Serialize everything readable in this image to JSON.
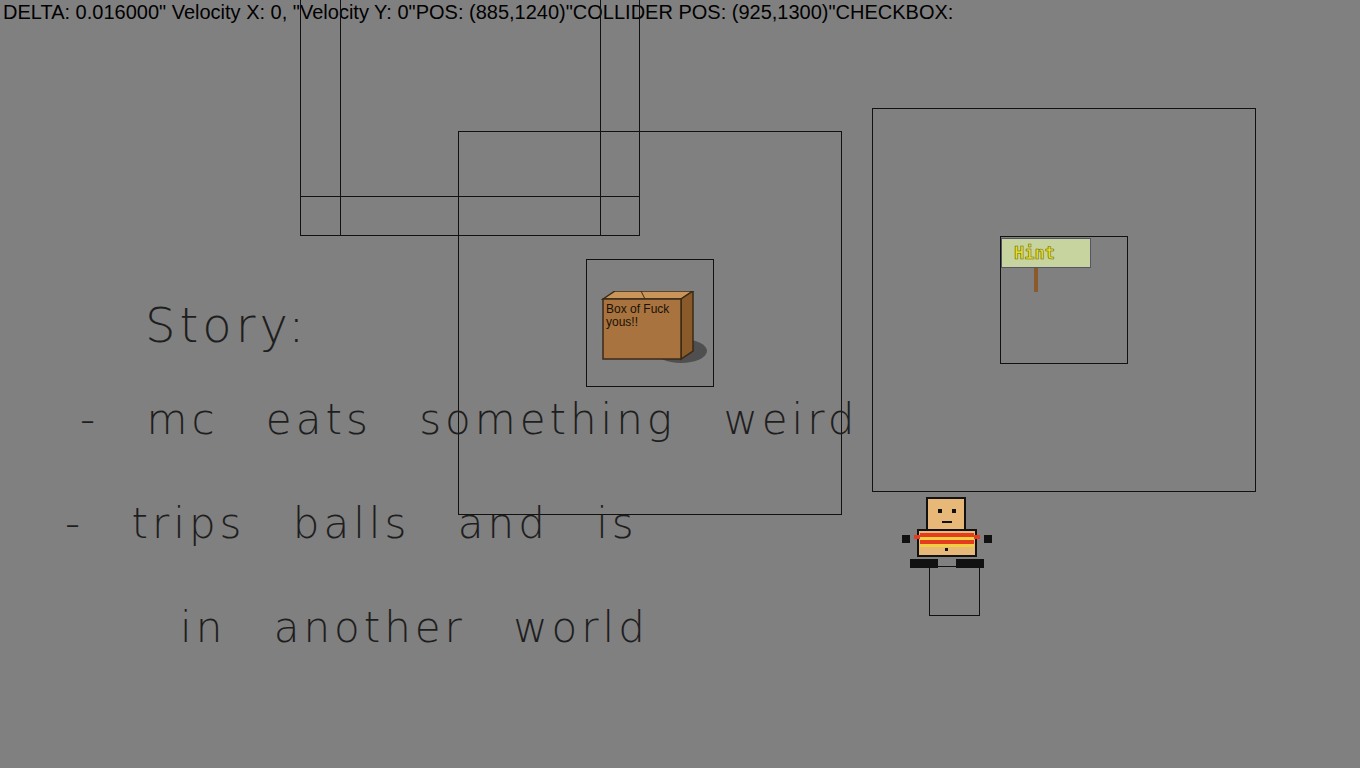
{
  "debug_bar": {
    "text": "DELTA: 0.016000\" Velocity X: 0, \"Velocity Y: 0\"POS: (885,1240)\"COLLIDER POS: (925,1300)\"CHECKBOX:"
  },
  "objects": [
    {
      "name": "box",
      "label": "Box of Fuck yous!!"
    },
    {
      "name": "sign",
      "label": "Hint"
    }
  ],
  "story": {
    "title": "Story:",
    "lines": [
      "- mc eats something weird",
      "- trips balls and is",
      "in another world"
    ]
  }
}
